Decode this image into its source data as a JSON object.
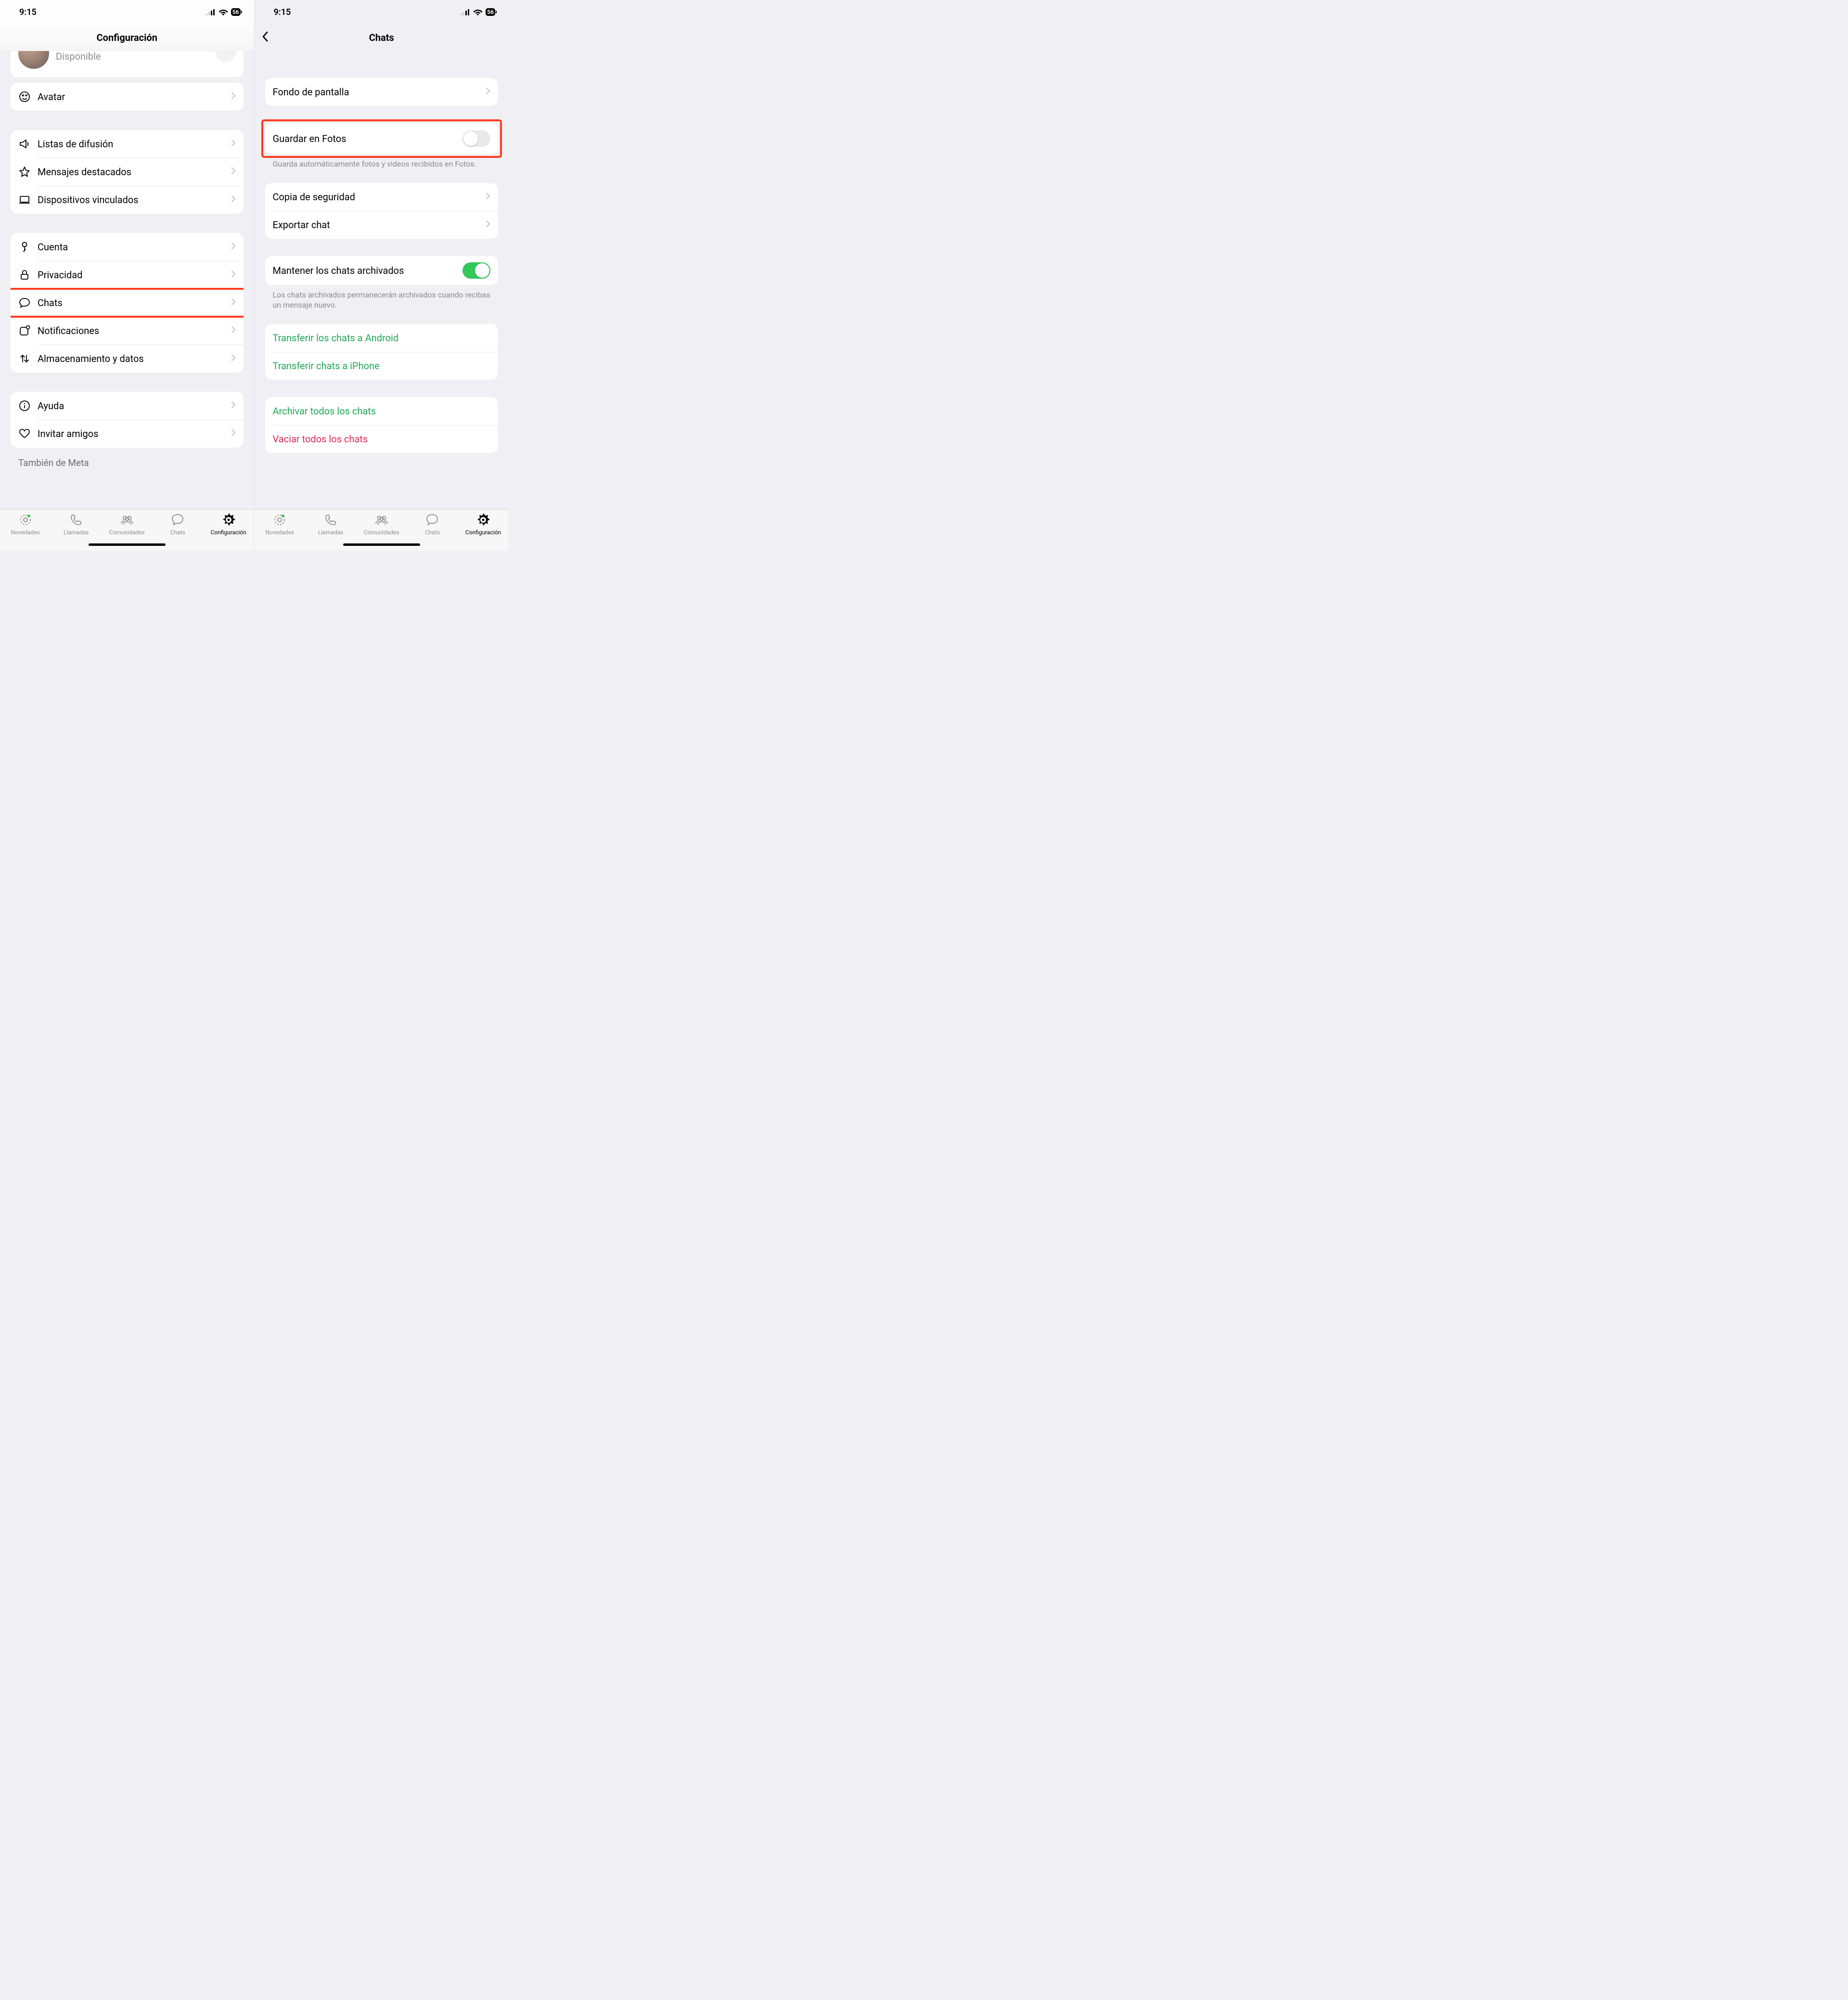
{
  "status": {
    "time": "9:15",
    "battery": "56"
  },
  "left": {
    "title": "Configuración",
    "profile_status": "Disponible",
    "avatar_label": "Avatar",
    "group2": {
      "broadcast": "Listas de difusión",
      "starred": "Mensajes destacados",
      "linked": "Dispositivos vinculados"
    },
    "group3": {
      "account": "Cuenta",
      "privacy": "Privacidad",
      "chats": "Chats",
      "notifications": "Notificaciones",
      "storage": "Almacenamiento y datos"
    },
    "group4": {
      "help": "Ayuda",
      "invite": "Invitar amigos"
    },
    "also_meta": "También de Meta"
  },
  "right": {
    "title": "Chats",
    "wallpaper": "Fondo de pantalla",
    "save_photos": "Guardar en Fotos",
    "save_photos_footer": "Guarda automáticamente fotos y videos recibidos en Fotos.",
    "backup": "Copia de seguridad",
    "export": "Exportar chat",
    "keep_archived": "Mantener los chats archivados",
    "keep_archived_footer": "Los chats archivados permanecerán archivados cuando recibas un mensaje nuevo.",
    "transfer_android": "Transferir los chats a Android",
    "transfer_iphone": "Transferir chats a iPhone",
    "archive_all": "Archivar todos los chats",
    "clear_all": "Vaciar todos los chats"
  },
  "tabs": {
    "updates": "Novedades",
    "calls": "Llamadas",
    "communities": "Comunidades",
    "chats": "Chats",
    "settings": "Configuración"
  }
}
